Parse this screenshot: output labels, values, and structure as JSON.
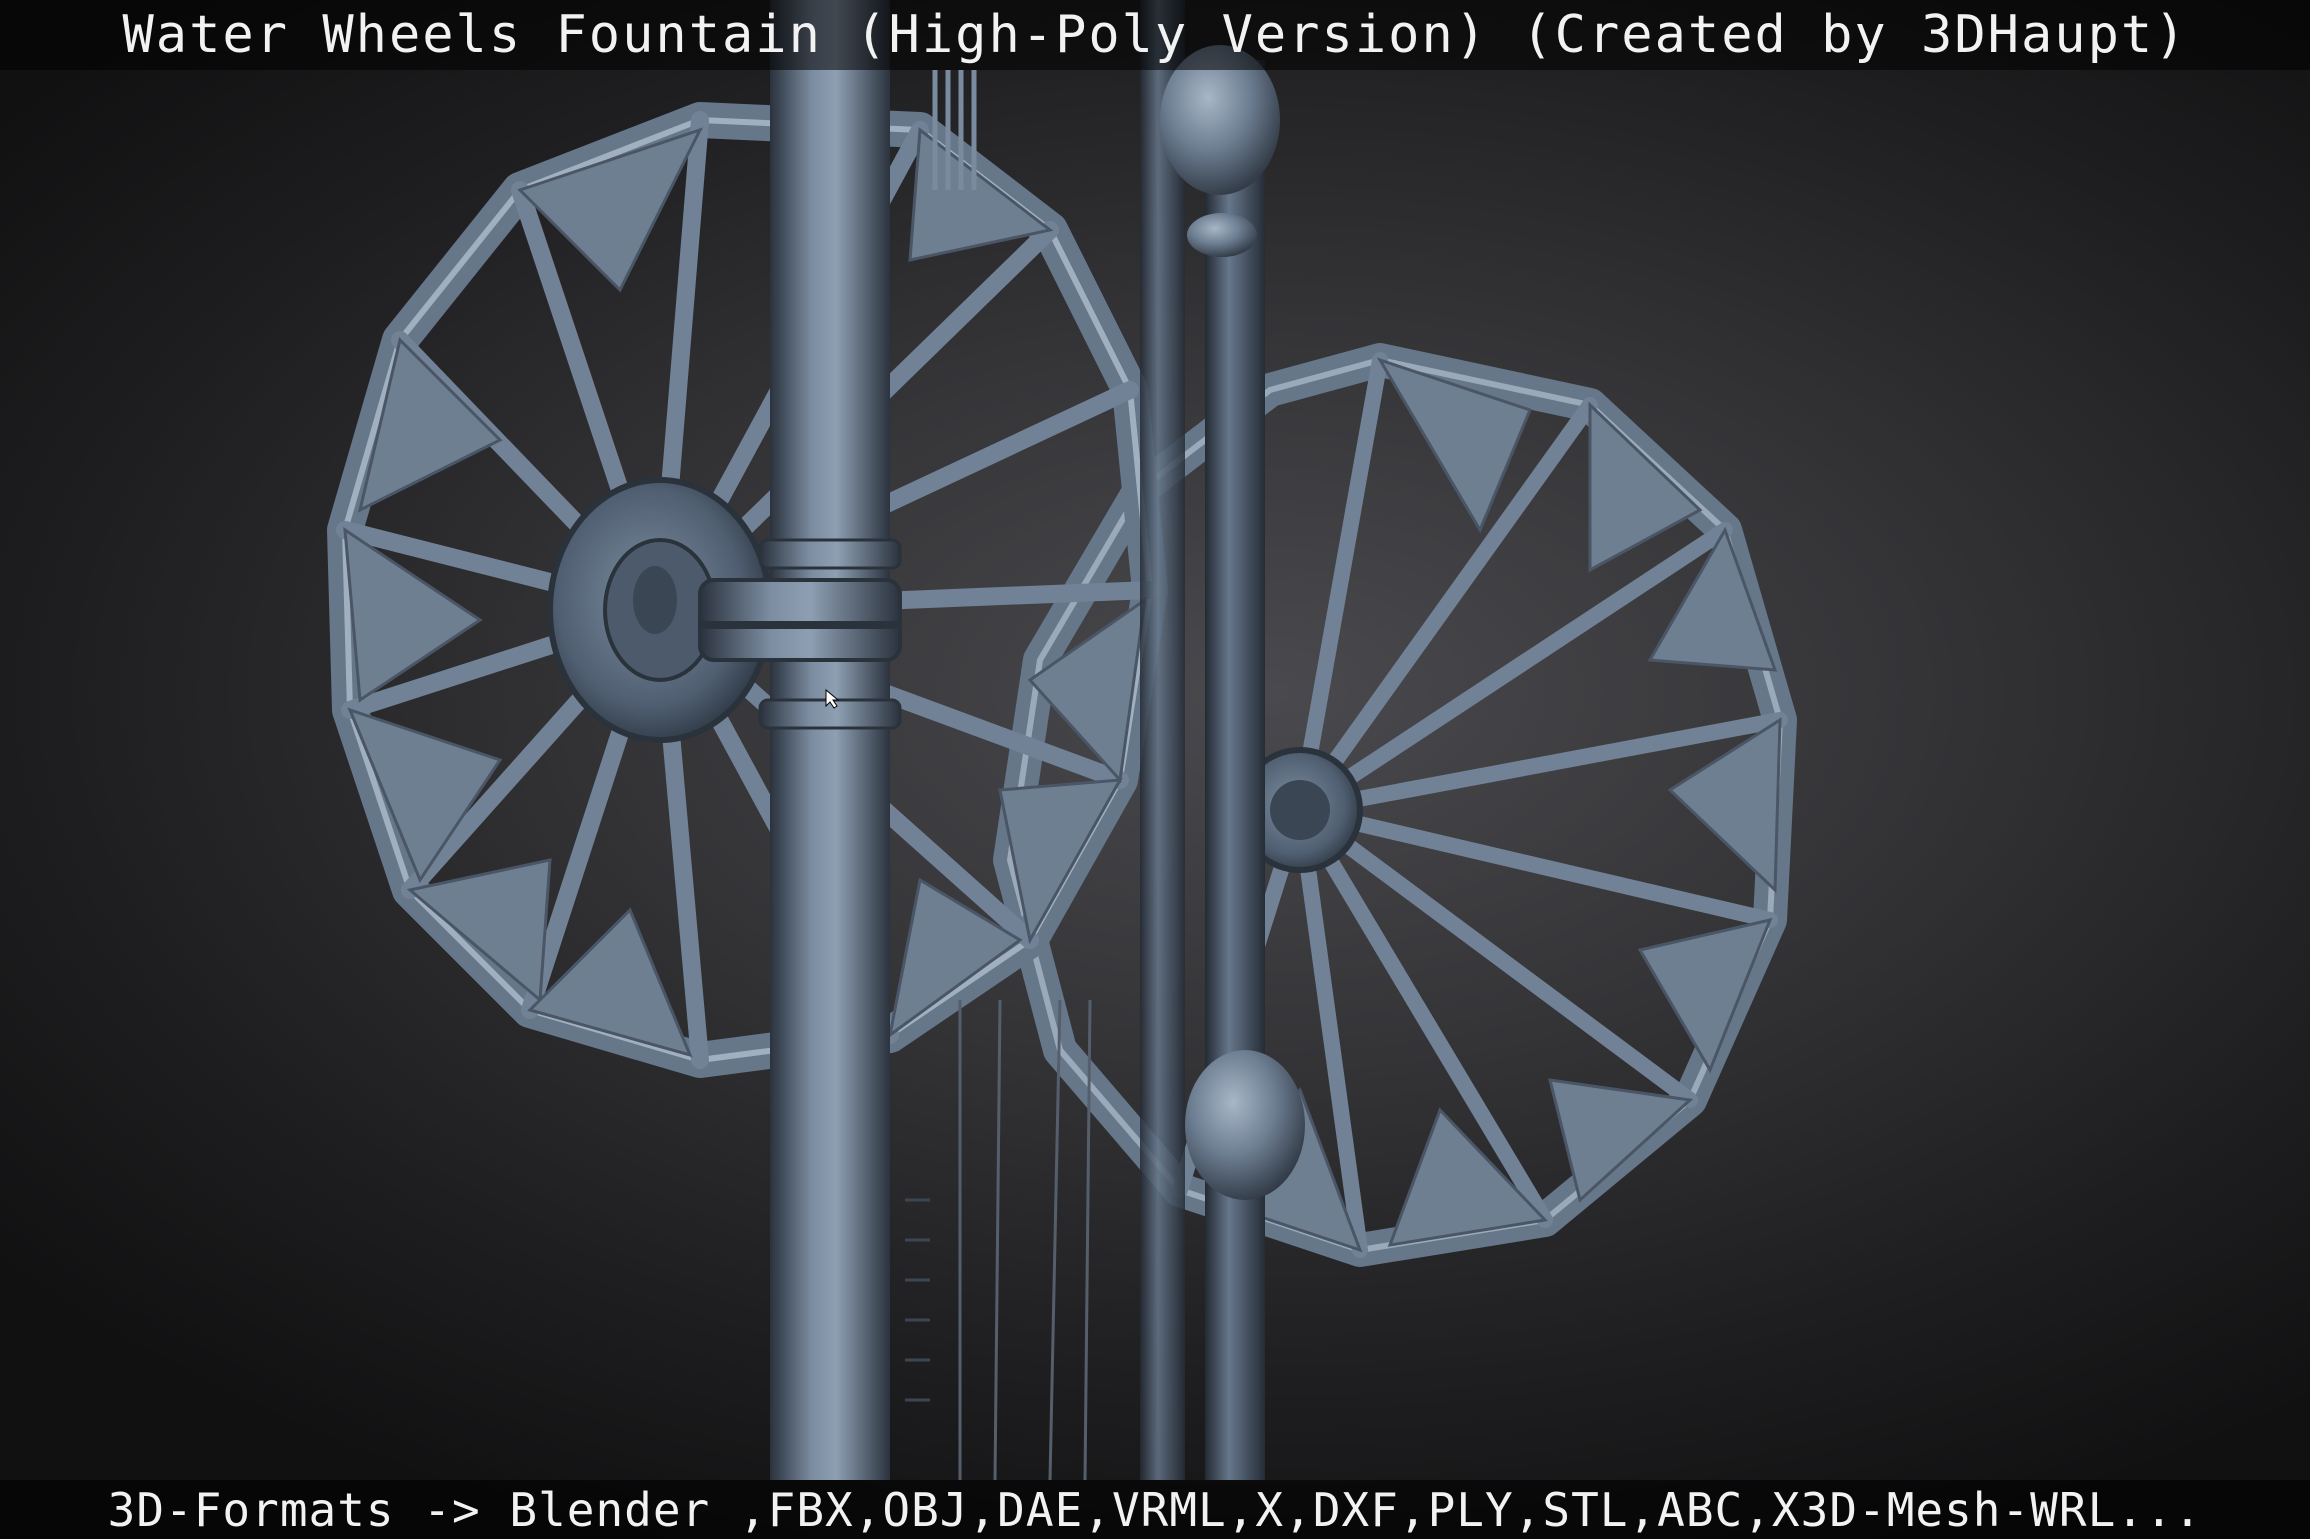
{
  "header": {
    "title": "Water Wheels Fountain (High-Poly Version) (Created by 3DHaupt)"
  },
  "footer": {
    "formats": "3D-Formats -> Blender ,FBX,OBJ,DAE,VRML,X,DXF,PLY,STL,ABC,X3D-Mesh-WRL..."
  },
  "scene": {
    "subject": "water-wheels-fountain-render",
    "colors": {
      "background_center": "#4a4a4e",
      "background_edge": "#111112",
      "metal_light": "#8a9bb0",
      "metal_mid": "#5d6d80",
      "metal_dark": "#2f3844",
      "blade_fill": "#6f7f92"
    }
  }
}
